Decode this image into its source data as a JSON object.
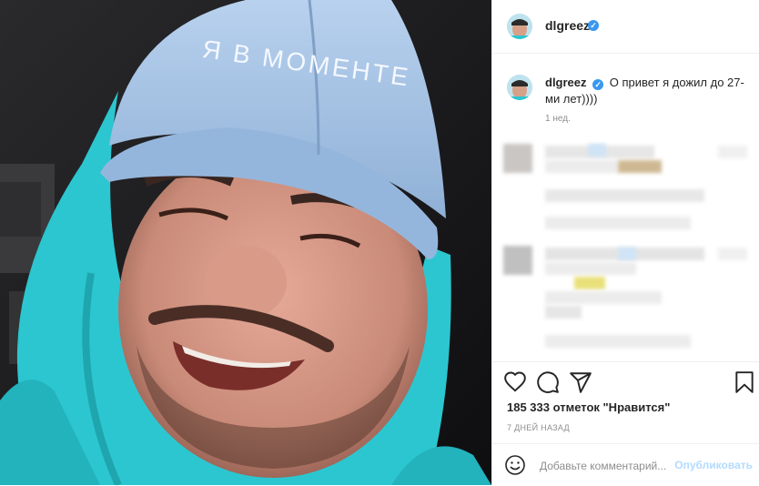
{
  "photo": {
    "cap_text": "Я В МОМЕНТЕ",
    "cap_color": "#a9c6e6",
    "hoodie_color": "#2cc6d0"
  },
  "header": {
    "username": "dlgreez",
    "verified_mark": "✓"
  },
  "caption": {
    "username": "dlgreez",
    "text": "О привет я дожил до 27-ми лет))))",
    "time_ago": "1 нед."
  },
  "actions": {
    "like_icon": "heart-icon",
    "comment_icon": "comment-icon",
    "share_icon": "share-icon",
    "save_icon": "bookmark-icon"
  },
  "likes_text": "185 333 отметок \"Нравится\"",
  "date_text": "7 ДНЕЙ НАЗАД",
  "comment_box": {
    "placeholder": "Добавьте комментарий...",
    "post_label": "Опубликовать",
    "emoji_icon": "smiley-icon"
  },
  "colors": {
    "accent": "#3897f0",
    "post_disabled": "#b3dbff",
    "muted": "#8e8e8e"
  }
}
